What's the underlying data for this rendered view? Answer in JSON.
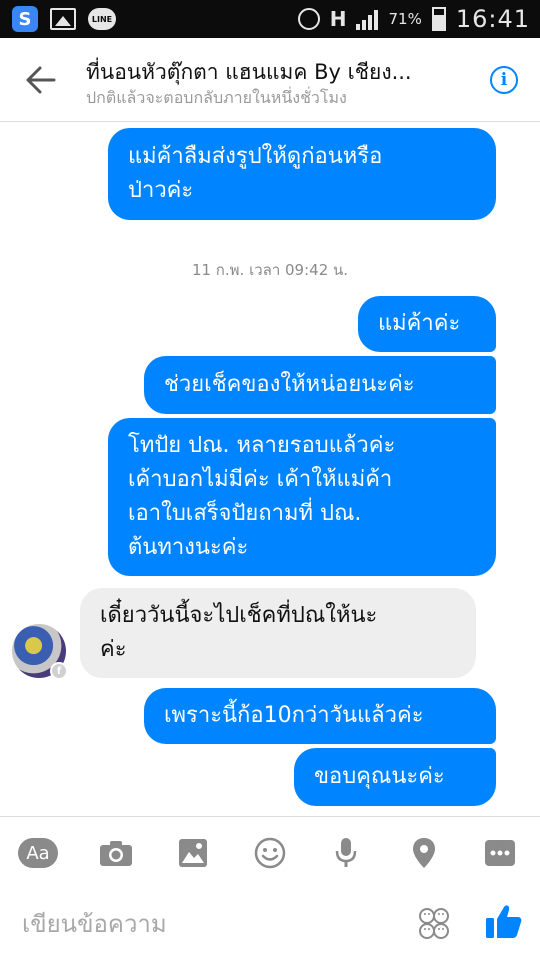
{
  "status_bar": {
    "app_letter": "S",
    "line_label": "LINE",
    "network_label": "H",
    "battery_text": "71%",
    "battery_level": 0.71,
    "time": "16:41"
  },
  "header": {
    "title": "ที่นอนหัวตุ๊กตา แฮนแมค By เชียง...",
    "subtitle": "ปกติแล้วจะตอบกลับภายในหนึ่งชั่วโมง",
    "info_label": "i"
  },
  "messages": [
    {
      "direction": "out",
      "lines": [
        "แม่ค้าลืมส่งรูปให้ดูก่อนหรือ",
        "ป่าวค่ะ"
      ]
    },
    {
      "direction": "out",
      "lines": [
        "แม่ค้าค่ะ"
      ]
    },
    {
      "direction": "out",
      "lines": [
        "ช่วยเช็คของให้หน่อยนะค่ะ"
      ]
    },
    {
      "direction": "out",
      "lines": [
        "โทปัย ปณ. หลายรอบแล้วค่ะ",
        "เค้าบอกไม่มีค่ะ เค้าให้แม่ค้า",
        "เอาใบเสร็จปัยถามที่ ปณ.",
        "ต้นทางนะค่ะ"
      ]
    },
    {
      "direction": "in",
      "lines": [
        "เดี๋ยววันนี้จะไปเช็คที่ปณให้นะ",
        "ค่ะ"
      ]
    },
    {
      "direction": "out",
      "lines": [
        "เพราะนี้ก้อ10กว่าวันแล้วค่ะ"
      ]
    },
    {
      "direction": "out",
      "lines": [
        "ขอบคุณนะค่ะ"
      ]
    }
  ],
  "timestamp": "11 ก.พ. เวลา 09:42 น.",
  "toolbar": {
    "aa_label": "Aa"
  },
  "composer": {
    "placeholder": "เขียนข้อความ"
  },
  "colors": {
    "outgoing_bubble": "#0084ff",
    "incoming_bubble": "#eeeeee",
    "accent": "#0084ff",
    "toolbar_icon": "#8a8a8a"
  }
}
